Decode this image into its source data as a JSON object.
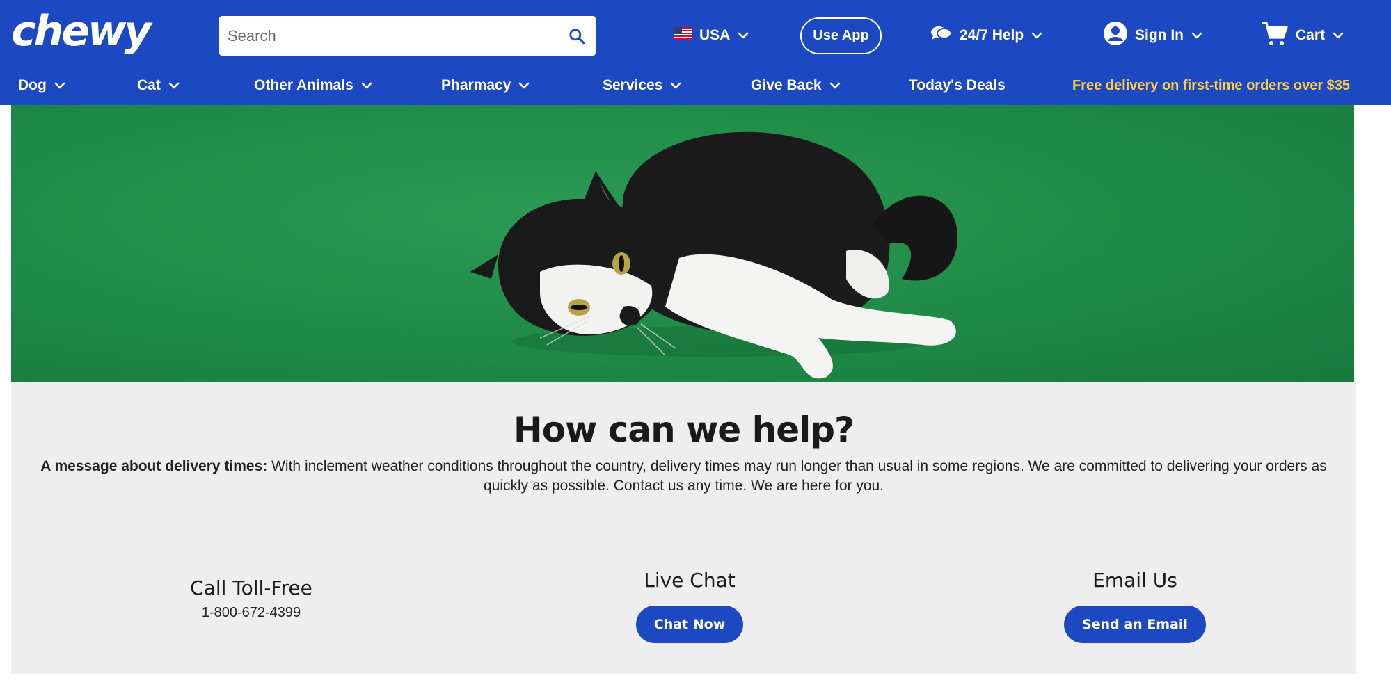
{
  "header": {
    "logo_text": "chewy",
    "search": {
      "placeholder": "Search"
    },
    "country": "USA",
    "use_app": "Use App",
    "help": "24/7 Help",
    "sign_in": "Sign In",
    "cart": "Cart"
  },
  "nav": {
    "items": [
      "Dog",
      "Cat",
      "Other Animals",
      "Pharmacy",
      "Services",
      "Give Back",
      "Today's Deals"
    ],
    "promo": "Free delivery on first-time orders over $35"
  },
  "help": {
    "title": "How can we help?",
    "message_bold": "A message about delivery times:",
    "message_text": "With inclement weather conditions throughout the country, delivery times may run longer than usual in some regions. We are committed to delivering your orders as quickly as possible. Contact us any time. We are here for you.",
    "call": {
      "title": "Call Toll-Free",
      "phone": "1-800-672-4399"
    },
    "chat": {
      "title": "Live Chat",
      "button": "Chat Now"
    },
    "email": {
      "title": "Email Us",
      "button": "Send an Email"
    }
  },
  "colors": {
    "brand_blue": "#1c49c2",
    "promo_yellow": "#ffcd45",
    "hero_green": "#1f8a47"
  }
}
